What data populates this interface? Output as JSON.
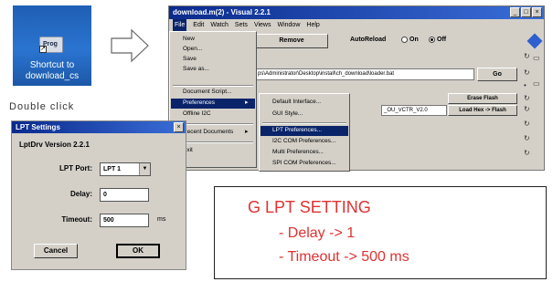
{
  "shortcut": {
    "icon_text": "Prog",
    "label_line1": "Shortcut to",
    "label_line2": "download_cs",
    "caption": "Double click"
  },
  "window": {
    "title": "download.m(2) - Visual 2.2.1",
    "menu": [
      "File",
      "Edit",
      "Watch",
      "Sets",
      "Views",
      "Window",
      "Help"
    ],
    "remove_button": "Remove",
    "autoreload_label": "AutoReload",
    "radio_on": "On",
    "radio_off": "Off",
    "autoreload_selected": "Off",
    "path_value": "ps\\Administrator\\Desktop\\install\\ch_download\\loader.bat",
    "go_button": "Go",
    "erase_button": "Erase Flash",
    "file_value": "_OU_VCTR_V2.0",
    "load_button": "Load Hex -> Flash",
    "file_menu": {
      "items": [
        "New",
        "Open...",
        "Save",
        "Save as...",
        "Document Script...",
        "Preferences",
        "Offline I2C",
        "Recent Documents",
        "Exit"
      ],
      "highlighted": "Preferences"
    },
    "submenu": {
      "items": [
        "Default Interface...",
        "GUI Style...",
        "LPT Preferences...",
        "I2C COM Preferences...",
        "Multi Preferences...",
        "SPI COM Preferences..."
      ],
      "highlighted": "LPT Preferences..."
    }
  },
  "dialog": {
    "title": "LPT Settings",
    "version": "LptDrv Version 2.2.1",
    "lpt_port_label": "LPT Port:",
    "lpt_port_value": "LPT 1",
    "delay_label": "Delay:",
    "delay_value": "0",
    "timeout_label": "Timeout:",
    "timeout_value": "500",
    "timeout_unit": "ms",
    "cancel_button": "Cancel",
    "ok_button": "OK"
  },
  "note": {
    "heading": "G LPT SETTING",
    "line1": "- Delay -> 1",
    "line2": "- Timeout -> 500 ms"
  },
  "colors": {
    "title_bar": "#0a2a8c",
    "highlight": "#0a246a",
    "note_text": "#e03131",
    "dialog_bg": "#d4d0c8"
  }
}
